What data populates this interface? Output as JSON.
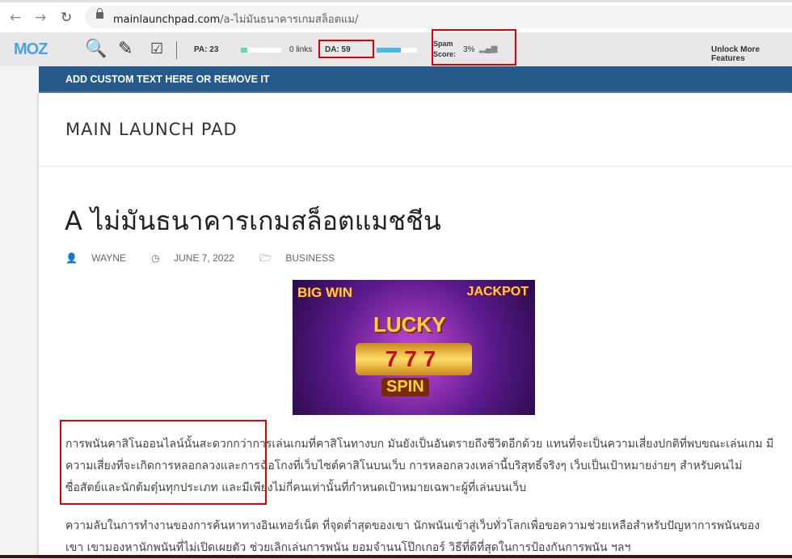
{
  "browser": {
    "url_host": "mainlaunchpad.com",
    "url_path": "/a-ไม่มันธนาคารเกมสล็อตแม/"
  },
  "moz": {
    "logo": "MOZ",
    "pa": "PA: 23",
    "pa_fraction": 0.15,
    "links": "0 links",
    "da": "DA: 59",
    "da_fraction": 0.59,
    "spam_label1": "Spam",
    "spam_label2": "Score:",
    "spam_value": "3%",
    "unlock": "Unlock More Features"
  },
  "banner": "ADD CUSTOM TEXT HERE OR REMOVE IT",
  "site_title": "MAIN LAUNCH PAD",
  "post": {
    "title": "A ไม่มันธนาคารเกมสล็อตแมชชีน",
    "author": "WAYNE",
    "date": "JUNE 7, 2022",
    "category": "BUSINESS",
    "image_text": [
      "BIG WIN",
      "JACKPOT",
      "LUCKY",
      "777",
      "SPIN"
    ],
    "paragraphs": [
      "การพนันคาสิโนออนไลน์นั้นสะดวกกว่าการเล่นเกมที่คาสิโนทางบก มันยังเป็นอันตรายถึงชีวิตอีกด้วย แทนที่จะเป็นความเสี่ยงปกติที่พบขณะเล่นเกม มีความเสี่ยงที่จะเกิดการหลอกลวงและการฉ้อโกงที่เว็บไซต์คาสิโนบนเว็บ การหลอกลวงเหล่านี้บริสุทธิ์จริงๆ เว็บเป็นเป้าหมายง่ายๆ สำหรับคนไม่ซื่อสัตย์และนักต้มตุ๋นทุกประเภท และมีเพียงไม่กี่คนเท่านั้นที่กำหนดเป้าหมายเฉพาะผู้ที่เล่นบนเว็บ",
      "ความลับในการทำงานของการค้นหาทางอินเทอร์เน็ต ที่จุดต่ำสุดของเขา นักพนันเข้าสู่เว็บทั่วโลกเพื่อขอความช่วยเหลือสำหรับปัญหาการพนันของเขา เขามองหานักพนันที่ไม่เปิดเผยตัว ช่วยเลิกเล่นการพนัน ยอมจำนนโป๊กเกอร์ วิธีที่ดีที่สุดในการป้องกันการพนัน ฯลฯ"
    ]
  }
}
